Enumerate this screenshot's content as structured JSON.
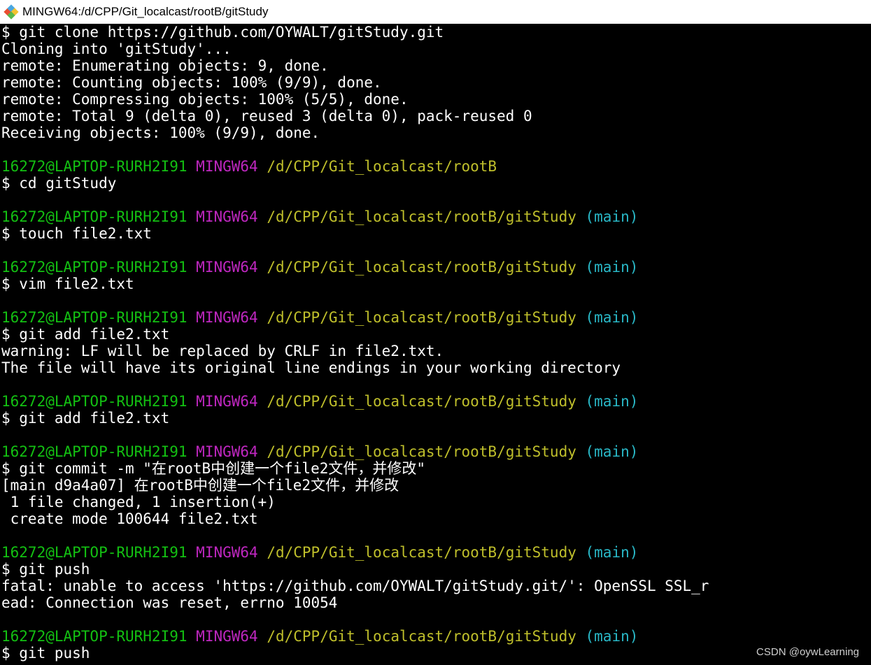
{
  "window": {
    "title": "MINGW64:/d/CPP/Git_localcast/rootB/gitStudy",
    "icon": "git-bash-icon"
  },
  "colors": {
    "background": "#000000",
    "text": "#ffffff",
    "user_host": "#13c012",
    "mingw": "#bf27c0",
    "path": "#bfbf2b",
    "branch": "#29b8c7"
  },
  "terminal": {
    "lines": [
      {
        "text": "$ git clone https://github.com/OYWALT/gitStudy.git"
      },
      {
        "text": "Cloning into 'gitStudy'..."
      },
      {
        "text": "remote: Enumerating objects: 9, done."
      },
      {
        "text": "remote: Counting objects: 100% (9/9), done."
      },
      {
        "text": "remote: Compressing objects: 100% (5/5), done."
      },
      {
        "text": "remote: Total 9 (delta 0), reused 3 (delta 0), pack-reused 0"
      },
      {
        "text": "Receiving objects: 100% (9/9), done."
      },
      {
        "text": ""
      },
      {
        "prompt": {
          "user": "16272@LAPTOP-RURH2I91",
          "sys": "MINGW64",
          "path": "/d/CPP/Git_localcast/rootB",
          "branch": ""
        }
      },
      {
        "text": "$ cd gitStudy"
      },
      {
        "text": ""
      },
      {
        "prompt": {
          "user": "16272@LAPTOP-RURH2I91",
          "sys": "MINGW64",
          "path": "/d/CPP/Git_localcast/rootB/gitStudy",
          "branch": "(main)"
        }
      },
      {
        "text": "$ touch file2.txt"
      },
      {
        "text": ""
      },
      {
        "prompt": {
          "user": "16272@LAPTOP-RURH2I91",
          "sys": "MINGW64",
          "path": "/d/CPP/Git_localcast/rootB/gitStudy",
          "branch": "(main)"
        }
      },
      {
        "text": "$ vim file2.txt"
      },
      {
        "text": ""
      },
      {
        "prompt": {
          "user": "16272@LAPTOP-RURH2I91",
          "sys": "MINGW64",
          "path": "/d/CPP/Git_localcast/rootB/gitStudy",
          "branch": "(main)"
        }
      },
      {
        "text": "$ git add file2.txt"
      },
      {
        "text": "warning: LF will be replaced by CRLF in file2.txt."
      },
      {
        "text": "The file will have its original line endings in your working directory"
      },
      {
        "text": ""
      },
      {
        "prompt": {
          "user": "16272@LAPTOP-RURH2I91",
          "sys": "MINGW64",
          "path": "/d/CPP/Git_localcast/rootB/gitStudy",
          "branch": "(main)"
        }
      },
      {
        "text": "$ git add file2.txt"
      },
      {
        "text": ""
      },
      {
        "prompt": {
          "user": "16272@LAPTOP-RURH2I91",
          "sys": "MINGW64",
          "path": "/d/CPP/Git_localcast/rootB/gitStudy",
          "branch": "(main)"
        }
      },
      {
        "text": "$ git commit -m \"在rootB中创建一个file2文件，并修改\""
      },
      {
        "text": "[main d9a4a07] 在rootB中创建一个file2文件，并修改"
      },
      {
        "text": " 1 file changed, 1 insertion(+)"
      },
      {
        "text": " create mode 100644 file2.txt"
      },
      {
        "text": ""
      },
      {
        "prompt": {
          "user": "16272@LAPTOP-RURH2I91",
          "sys": "MINGW64",
          "path": "/d/CPP/Git_localcast/rootB/gitStudy",
          "branch": "(main)"
        }
      },
      {
        "text": "$ git push"
      },
      {
        "text": "fatal: unable to access 'https://github.com/OYWALT/gitStudy.git/': OpenSSL SSL_r"
      },
      {
        "text": "ead: Connection was reset, errno 10054"
      },
      {
        "text": ""
      },
      {
        "prompt": {
          "user": "16272@LAPTOP-RURH2I91",
          "sys": "MINGW64",
          "path": "/d/CPP/Git_localcast/rootB/gitStudy",
          "branch": "(main)"
        }
      },
      {
        "text": "$ git push"
      }
    ]
  },
  "watermark": {
    "text": "CSDN @oywLearning"
  }
}
